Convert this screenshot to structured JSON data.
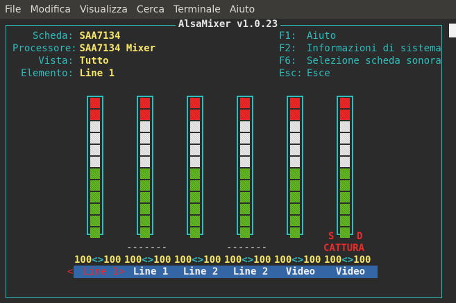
{
  "menu": [
    "File",
    "Modifica",
    "Visualizza",
    "Cerca",
    "Terminale",
    "Aiuto"
  ],
  "title": "AlsaMixer v1.0.23",
  "info": {
    "card_label": "Scheda:",
    "card_value": "SAA7134",
    "chip_label": "Processore:",
    "chip_value": "SAA7134 Mixer",
    "view_label": "Vista:",
    "view_value": "Tutto",
    "item_label": "Elemento:",
    "item_value": "Line 1"
  },
  "keys": [
    {
      "key": "F1:",
      "desc": "Aiuto"
    },
    {
      "key": "F2:",
      "desc": "Informazioni di sistema"
    },
    {
      "key": "F6:",
      "desc": "Selezione scheda sonora"
    },
    {
      "key": "Esc:",
      "desc": "Esce"
    }
  ],
  "channels": [
    {
      "name": "Line 1",
      "left": "100",
      "sep": "<>",
      "right": "100",
      "mark": "",
      "selected": true
    },
    {
      "name": "Line 1",
      "left": "100",
      "sep": "<>",
      "right": "100",
      "mark": "-------"
    },
    {
      "name": "Line 2",
      "left": "100",
      "sep": "<>",
      "right": "100",
      "mark": ""
    },
    {
      "name": "Line 2",
      "left": "100",
      "sep": "<>",
      "right": "100",
      "mark": "-------"
    },
    {
      "name": "Video",
      "left": "100",
      "sep": "<>",
      "right": "100",
      "mark": ""
    },
    {
      "name": "Video",
      "left": "100",
      "sep": "<>",
      "right": "100",
      "mark": ""
    }
  ],
  "capture": {
    "s": "S",
    "d": "D",
    "label": "CATTURA"
  },
  "selection_arrows": {
    "left": "<",
    "right": ">"
  },
  "meter_level": 1.0,
  "colors": {
    "frame": "#2fbcbc",
    "value": "#f5e56b",
    "red": "#ef2929",
    "channel_bg": "#3465a4"
  }
}
